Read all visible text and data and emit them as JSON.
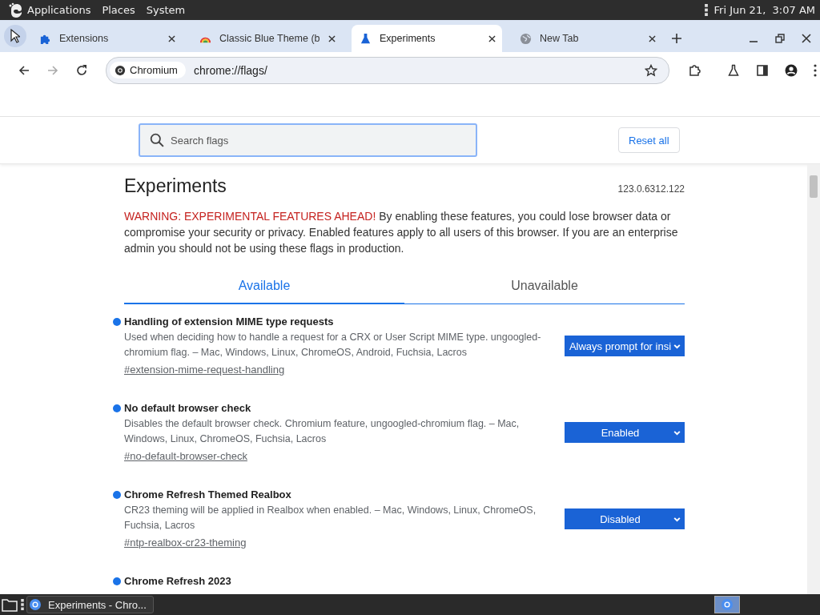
{
  "top_panel": {
    "menus": [
      "Applications",
      "Places",
      "System"
    ],
    "clock": "Fri Jun 21,  3:07 AM"
  },
  "tabs": [
    {
      "title": "Extensions",
      "selected": false
    },
    {
      "title": "Classic Blue Theme (b",
      "selected": false
    },
    {
      "title": "Experiments",
      "selected": true
    },
    {
      "title": "New Tab",
      "selected": false
    }
  ],
  "address_bar": {
    "chip": "Chromium",
    "url": "chrome://flags/"
  },
  "search": {
    "placeholder": "Search flags"
  },
  "reset_button": "Reset all",
  "heading": "Experiments",
  "version": "123.0.6312.122",
  "warning": {
    "label": "WARNING: EXPERIMENTAL FEATURES AHEAD!",
    "text": "By enabling these features, you could lose browser data or compromise your security or privacy. Enabled features apply to all users of this browser. If you are an enterprise admin you should not be using these flags in production."
  },
  "page_tabs": [
    {
      "label": "Available",
      "selected": true
    },
    {
      "label": "Unavailable",
      "selected": false
    }
  ],
  "flags": [
    {
      "name": "Handling of extension MIME type requests",
      "description": "Used when deciding how to handle a request for a CRX or User Script MIME type. ungoogled-chromium flag. – Mac, Windows, Linux, ChromeOS, Android, Fuchsia, Lacros",
      "link": "#extension-mime-request-handling",
      "value": "Always prompt for insi"
    },
    {
      "name": "No default browser check",
      "description": "Disables the default browser check. Chromium feature, ungoogled-chromium flag. – Mac, Windows, Linux, ChromeOS, Fuchsia, Lacros",
      "link": "#no-default-browser-check",
      "value": "Enabled"
    },
    {
      "name": "Chrome Refresh Themed Realbox",
      "description": "CR23 theming will be applied in Realbox when enabled. – Mac, Windows, Linux, ChromeOS, Fuchsia, Lacros",
      "link": "#ntp-realbox-cr23-theming",
      "value": "Disabled"
    },
    {
      "name": "Chrome Refresh 2023"
    }
  ],
  "taskbar": {
    "window": "Experiments - Chro..."
  }
}
